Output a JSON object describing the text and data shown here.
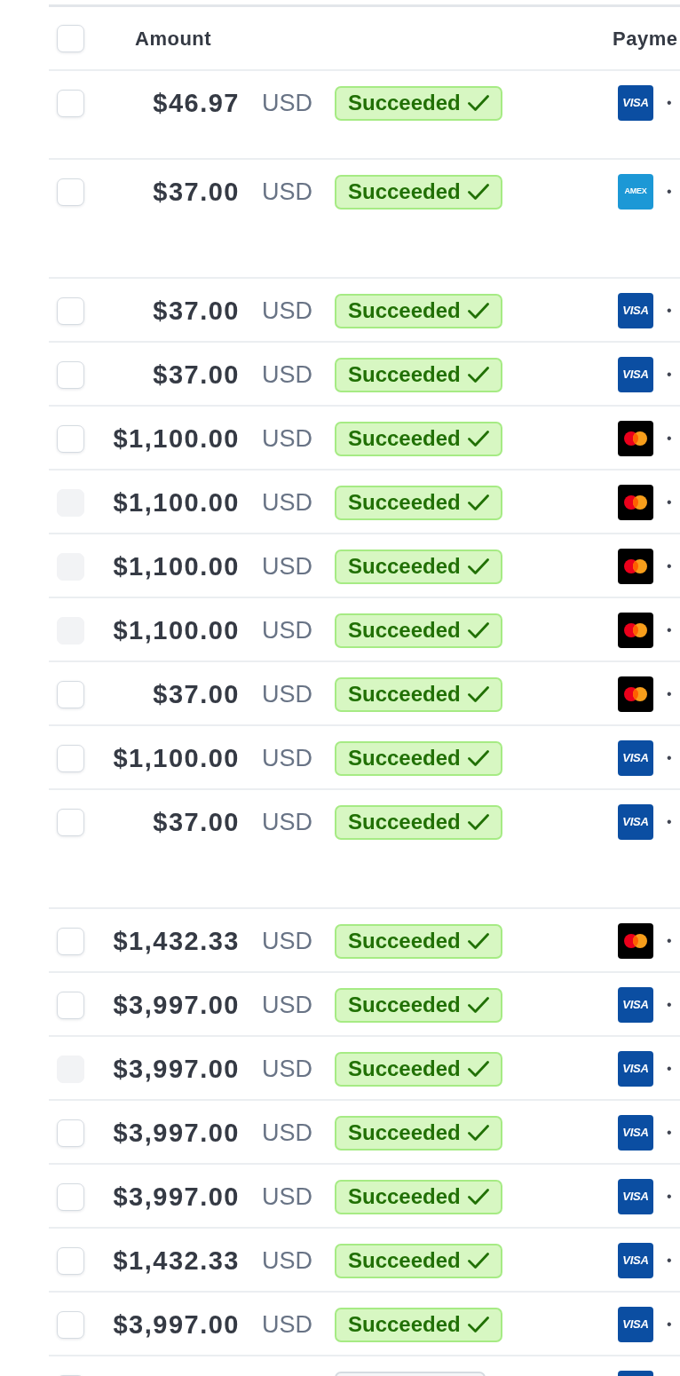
{
  "table": {
    "header": {
      "checkbox": {
        "checked": false,
        "disabled": false
      },
      "columns": [
        "Amount",
        "Payme"
      ]
    },
    "rows": [
      {
        "checkbox": {
          "checked": false,
          "disabled": false
        },
        "amount": "$46.97",
        "currency": "USD",
        "status": {
          "kind": "succeeded",
          "label": "Succeeded"
        },
        "card": {
          "kind": "visa",
          "label": "VISA",
          "number": "•"
        }
      },
      {
        "checkbox": {
          "checked": false,
          "disabled": false
        },
        "amount": "$37.00",
        "currency": "USD",
        "status": {
          "kind": "succeeded",
          "label": "Succeeded"
        },
        "card": {
          "kind": "amex",
          "label": "AMEX",
          "number": "•"
        }
      },
      {
        "checkbox": {
          "checked": false,
          "disabled": false
        },
        "amount": "$37.00",
        "currency": "USD",
        "status": {
          "kind": "succeeded",
          "label": "Succeeded"
        },
        "card": {
          "kind": "visa",
          "label": "VISA",
          "number": "•"
        }
      },
      {
        "checkbox": {
          "checked": false,
          "disabled": false
        },
        "amount": "$37.00",
        "currency": "USD",
        "status": {
          "kind": "succeeded",
          "label": "Succeeded"
        },
        "card": {
          "kind": "visa",
          "label": "VISA",
          "number": "•"
        }
      },
      {
        "checkbox": {
          "checked": false,
          "disabled": false
        },
        "amount": "$1,100.00",
        "currency": "USD",
        "status": {
          "kind": "succeeded",
          "label": "Succeeded"
        },
        "card": {
          "kind": "mastercard",
          "number": "•"
        }
      },
      {
        "checkbox": {
          "checked": false,
          "disabled": true
        },
        "amount": "$1,100.00",
        "currency": "USD",
        "status": {
          "kind": "succeeded",
          "label": "Succeeded"
        },
        "card": {
          "kind": "mastercard",
          "number": "•"
        }
      },
      {
        "checkbox": {
          "checked": false,
          "disabled": true
        },
        "amount": "$1,100.00",
        "currency": "USD",
        "status": {
          "kind": "succeeded",
          "label": "Succeeded"
        },
        "card": {
          "kind": "mastercard",
          "number": "•"
        }
      },
      {
        "checkbox": {
          "checked": false,
          "disabled": true
        },
        "amount": "$1,100.00",
        "currency": "USD",
        "status": {
          "kind": "succeeded",
          "label": "Succeeded"
        },
        "card": {
          "kind": "mastercard",
          "number": "•"
        }
      },
      {
        "checkbox": {
          "checked": false,
          "disabled": false
        },
        "amount": "$37.00",
        "currency": "USD",
        "status": {
          "kind": "succeeded",
          "label": "Succeeded"
        },
        "card": {
          "kind": "mastercard",
          "number": "•"
        }
      },
      {
        "checkbox": {
          "checked": false,
          "disabled": false
        },
        "amount": "$1,100.00",
        "currency": "USD",
        "status": {
          "kind": "succeeded",
          "label": "Succeeded"
        },
        "card": {
          "kind": "visa",
          "label": "VISA",
          "number": "•"
        }
      },
      {
        "checkbox": {
          "checked": false,
          "disabled": false
        },
        "amount": "$37.00",
        "currency": "USD",
        "status": {
          "kind": "succeeded",
          "label": "Succeeded"
        },
        "card": {
          "kind": "visa",
          "label": "VISA",
          "number": "•"
        }
      },
      {
        "checkbox": {
          "checked": false,
          "disabled": false
        },
        "amount": "$1,432.33",
        "currency": "USD",
        "status": {
          "kind": "succeeded",
          "label": "Succeeded"
        },
        "card": {
          "kind": "mastercard",
          "number": "•"
        }
      },
      {
        "checkbox": {
          "checked": false,
          "disabled": false
        },
        "amount": "$3,997.00",
        "currency": "USD",
        "status": {
          "kind": "succeeded",
          "label": "Succeeded"
        },
        "card": {
          "kind": "visa",
          "label": "VISA",
          "number": "•"
        }
      },
      {
        "checkbox": {
          "checked": false,
          "disabled": true
        },
        "amount": "$3,997.00",
        "currency": "USD",
        "status": {
          "kind": "succeeded",
          "label": "Succeeded"
        },
        "card": {
          "kind": "visa",
          "label": "VISA",
          "number": "•"
        }
      },
      {
        "checkbox": {
          "checked": false,
          "disabled": false
        },
        "amount": "$3,997.00",
        "currency": "USD",
        "status": {
          "kind": "succeeded",
          "label": "Succeeded"
        },
        "card": {
          "kind": "visa",
          "label": "VISA",
          "number": "•"
        }
      },
      {
        "checkbox": {
          "checked": false,
          "disabled": false
        },
        "amount": "$3,997.00",
        "currency": "USD",
        "status": {
          "kind": "succeeded",
          "label": "Succeeded"
        },
        "card": {
          "kind": "visa",
          "label": "VISA",
          "number": "•"
        }
      },
      {
        "checkbox": {
          "checked": false,
          "disabled": false
        },
        "amount": "$1,432.33",
        "currency": "USD",
        "status": {
          "kind": "succeeded",
          "label": "Succeeded"
        },
        "card": {
          "kind": "visa",
          "label": "VISA",
          "number": "•"
        }
      },
      {
        "checkbox": {
          "checked": false,
          "disabled": false
        },
        "amount": "$3,997.00",
        "currency": "USD",
        "status": {
          "kind": "succeeded",
          "label": "Succeeded"
        },
        "card": {
          "kind": "visa",
          "label": "VISA",
          "number": "•"
        }
      },
      {
        "checkbox": {
          "checked": false,
          "disabled": false
        },
        "status": {
          "kind": "neutral"
        },
        "card": {
          "kind": "visa"
        }
      }
    ]
  }
}
